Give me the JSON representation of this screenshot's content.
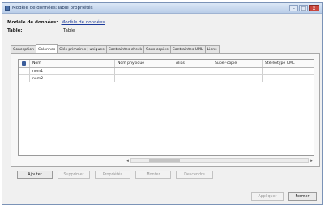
{
  "window": {
    "title": "Modèle de données:Table propriétés",
    "controls": {
      "minimize": "–",
      "maximize": "□",
      "close": "x"
    }
  },
  "model": {
    "label": "Modèle de données:",
    "value": "Modèle de données"
  },
  "table": {
    "label": "Table:",
    "value": "Table"
  },
  "tabs": [
    {
      "label": "Conception",
      "active": false
    },
    {
      "label": "Colonnes",
      "active": true
    },
    {
      "label": "Clés primaires | uniques",
      "active": false
    },
    {
      "label": "Contraintes check",
      "active": false
    },
    {
      "label": "Sous-copies",
      "active": false
    },
    {
      "label": "Contraintes UML",
      "active": false
    },
    {
      "label": "Liens",
      "active": false
    }
  ],
  "grid": {
    "headers": [
      "Nom",
      "Nom physique",
      "Alias",
      "Super-copie",
      "Stéréotype UML"
    ],
    "rows": [
      [
        "nom1",
        "",
        "",
        "",
        ""
      ],
      [
        "nom2",
        "",
        "",
        "",
        ""
      ]
    ]
  },
  "actions": {
    "add": "Ajouter",
    "delete": "Supprimer",
    "properties": "Propriétés",
    "up": "Monter",
    "down": "Descendre"
  },
  "footer": {
    "apply": "Appliquer",
    "close": "Fermer"
  },
  "icons": {
    "key": "key-icon",
    "app": "app-icon"
  },
  "colors": {
    "titlebar": "#c8d8ee",
    "link": "#1b3a9a",
    "close": "#c9463d"
  }
}
